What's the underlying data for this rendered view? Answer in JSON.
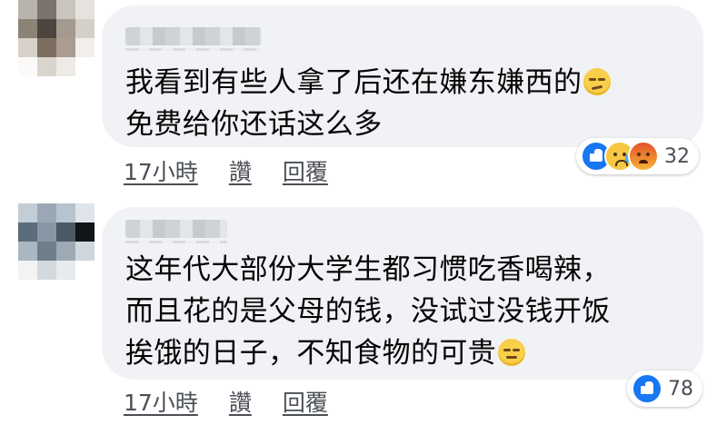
{
  "comments": [
    {
      "lines": [
        "我看到有些人拿了后还在嫌东嫌西的",
        "免费给你还话这么多"
      ],
      "line_emoji": [
        "unamused-face-icon",
        null
      ],
      "reaction_icons": [
        "like-icon",
        "sad-icon",
        "angry-icon"
      ],
      "reaction_count": "32",
      "time": "17小時",
      "like_label": "讚",
      "reply_label": "回覆"
    },
    {
      "lines": [
        "这年代大部份大学生都习惯吃香喝辣，",
        "而且花的是父母的钱，没试过没钱开饭",
        "挨饿的日子，不知食物的可贵"
      ],
      "line_emoji": [
        null,
        null,
        "expressionless-face-icon"
      ],
      "reaction_icons": [
        "like-icon"
      ],
      "reaction_count": "78",
      "time": "17小時",
      "like_label": "讚",
      "reply_label": "回覆"
    }
  ],
  "colors": {
    "bubble": "#f0f2f5",
    "like_blue": "#1877f2",
    "meta_text": "#4b4f56"
  }
}
